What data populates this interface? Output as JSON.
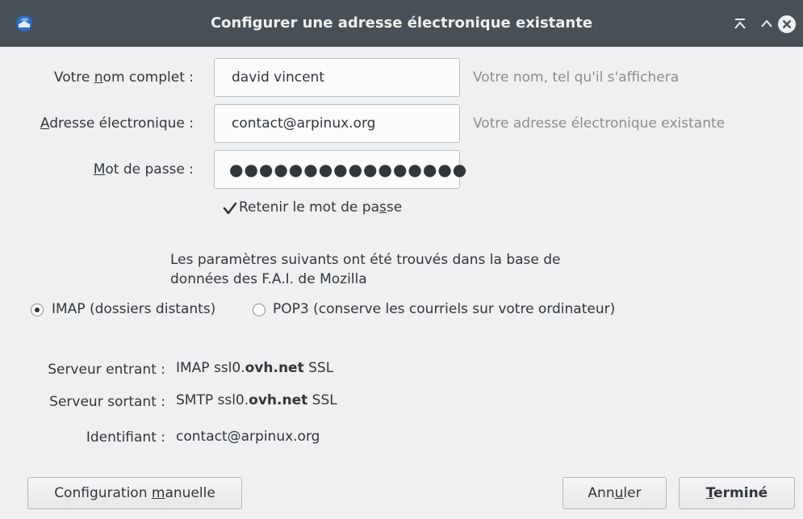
{
  "window": {
    "title": "Configurer une adresse électronique existante",
    "app_icon": "thunderbird-icon",
    "controls": [
      "keep-above-icon",
      "maximize-icon",
      "close-icon"
    ]
  },
  "form": {
    "name": {
      "label_pre": "Votre ",
      "label_accel": "n",
      "label_post": "om complet :",
      "value": "david vincent",
      "hint": "Votre nom, tel qu'il s'affichera"
    },
    "email": {
      "label_pre": "",
      "label_accel": "A",
      "label_post": "dresse électronique :",
      "value": "contact@arpinux.org",
      "hint": "Votre adresse électronique existante"
    },
    "password": {
      "label_pre": "",
      "label_accel": "M",
      "label_post": "ot de passe :",
      "value": "●●●●●●●●●●●●●●●●"
    },
    "remember": {
      "label_pre": "Retenir le mot de pa",
      "label_accel": "s",
      "label_post": "se",
      "checked": true
    }
  },
  "notice": {
    "line1": "Les paramètres suivants ont été trouvés dans la base de",
    "line2": "données des F.A.I. de Mozilla"
  },
  "protocol": {
    "imap_label": "IMAP (dossiers distants)",
    "pop3_label": "POP3 (conserve les courriels sur votre ordinateur)",
    "selected": "IMAP"
  },
  "servers": {
    "incoming": {
      "label": "Serveur entrant :",
      "pre": "IMAP ssl0.",
      "bold": "ovh.net",
      "post": " SSL"
    },
    "outgoing": {
      "label": "Serveur sortant :",
      "pre": "SMTP ssl0.",
      "bold": "ovh.net",
      "post": " SSL"
    },
    "identifier": {
      "label": "Identifiant :",
      "value": "contact@arpinux.org"
    }
  },
  "buttons": {
    "manual": {
      "pre": "Configuration ",
      "accel": "m",
      "post": "anuelle"
    },
    "cancel": {
      "pre": "Ann",
      "accel": "u",
      "post": "ler"
    },
    "done": {
      "pre": "",
      "accel": "T",
      "post": "erminé"
    }
  },
  "colors": {
    "titlebar": "#475057",
    "window_bg": "#eff0f1",
    "text": "#31363b",
    "hint": "#8a8d90"
  }
}
